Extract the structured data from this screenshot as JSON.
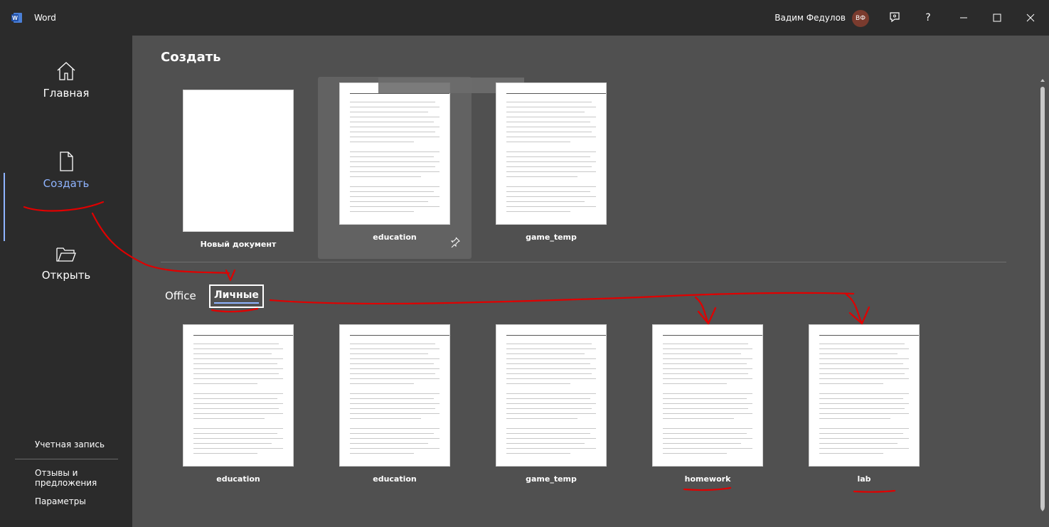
{
  "app": {
    "title": "Word"
  },
  "user": {
    "name": "Вадим Федулов",
    "initials": "ВФ"
  },
  "window_controls": {
    "help": "?"
  },
  "sidebar": {
    "items": [
      {
        "label": "Главная",
        "icon": "home-icon"
      },
      {
        "label": "Создать",
        "icon": "new-document-icon",
        "active": true
      },
      {
        "label": "Открыть",
        "icon": "open-folder-icon"
      }
    ],
    "bottom_links": [
      {
        "label": "Учетная запись"
      },
      {
        "label": "Отзывы и предложения"
      },
      {
        "label": "Параметры"
      }
    ]
  },
  "main": {
    "title": "Создать",
    "featured": [
      {
        "name": "Новый документ",
        "blank": true
      },
      {
        "name": "education",
        "pinned": true
      },
      {
        "name": "game_temp"
      }
    ],
    "tabs": [
      {
        "label": "Office",
        "selected": false
      },
      {
        "label": "Личные",
        "selected": true
      }
    ],
    "personal_templates": [
      {
        "name": "education"
      },
      {
        "name": "education"
      },
      {
        "name": "game_temp"
      },
      {
        "name": "homework"
      },
      {
        "name": "lab"
      }
    ]
  },
  "colors": {
    "background": "#505050",
    "chrome": "#2b2b2b",
    "accent": "#8fb4ff",
    "annotation": "#e00000"
  }
}
